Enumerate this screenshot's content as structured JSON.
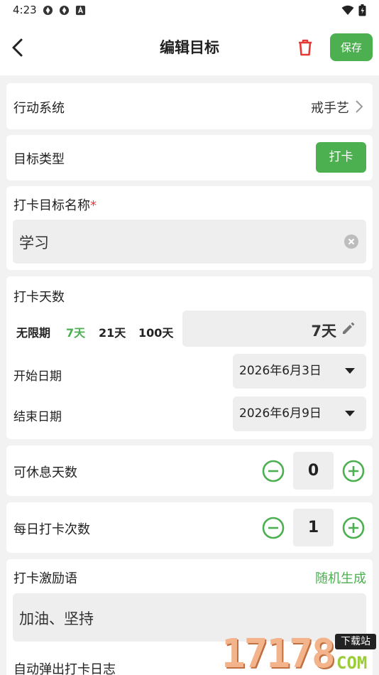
{
  "status_bar": {
    "time": "4:23"
  },
  "header": {
    "title": "编辑目标",
    "save_label": "保存"
  },
  "action_system": {
    "label": "行动系统",
    "value": "戒手艺"
  },
  "goal_type": {
    "label": "目标类型",
    "value": "打卡"
  },
  "goal_name": {
    "label": "打卡目标名称",
    "required_mark": "*",
    "value": "学习"
  },
  "days": {
    "label": "打卡天数",
    "options": [
      "无限期",
      "7天",
      "21天",
      "100天"
    ],
    "selected": "7天",
    "custom_value": "7天"
  },
  "start_date": {
    "label": "开始日期",
    "value": "2026年6月3日"
  },
  "end_date": {
    "label": "结束日期",
    "value": "2026年6月9日"
  },
  "rest_days": {
    "label": "可休息天数",
    "value": "0"
  },
  "daily_count": {
    "label": "每日打卡次数",
    "value": "1"
  },
  "motto": {
    "label": "打卡激励语",
    "random_label": "随机生成",
    "value": "加油、坚持"
  },
  "auto_popup": {
    "label": "自动弹出打卡日志"
  },
  "watermark": {
    "text": "17178",
    "badge": "下载站",
    "domain": "COM"
  },
  "colors": {
    "accent": "#4caf50",
    "danger": "#e53935"
  }
}
